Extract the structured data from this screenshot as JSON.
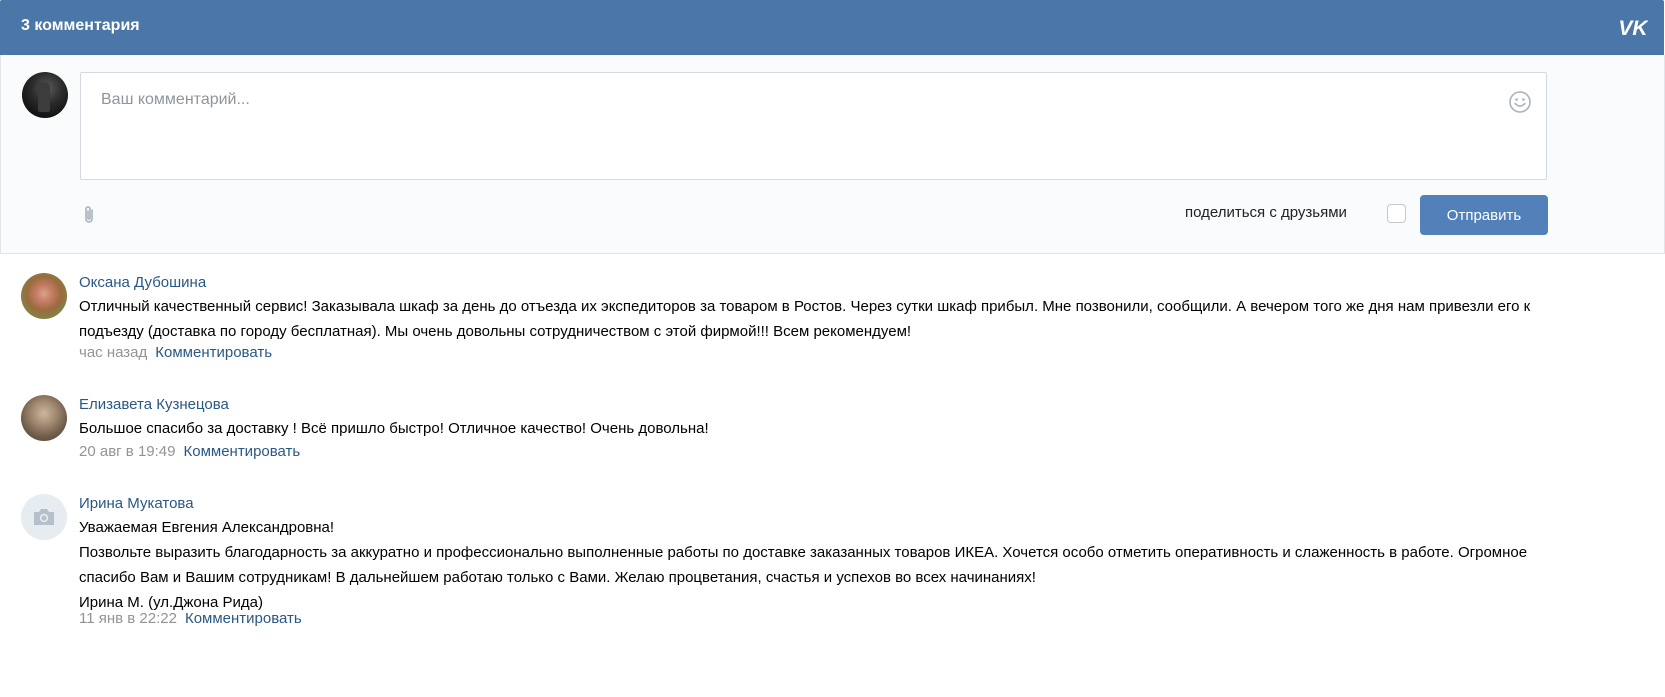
{
  "header": {
    "title": "3 комментария",
    "logo": "VK"
  },
  "compose": {
    "placeholder": "Ваш комментарий...",
    "share_label": "поделиться с друзьями",
    "share_checked": false,
    "send_label": "Отправить"
  },
  "comments": [
    {
      "author": "Оксана Дубошина",
      "text": "Отличный качественный сервис! Заказывала шкаф за день до отъезда их экспедиторов за товаром в Ростов. Через сутки шкаф прибыл. Мне позвонили, сообщили. А вечером того же дня нам привезли его к подъезду (доставка по городу бесплатная). Мы очень довольны сотрудничеством с этой фирмой!!! Всем рекомендуем!",
      "time": "час назад",
      "reply_label": "Комментировать"
    },
    {
      "author": "Елизавета Кузнецова",
      "text": "Большое спасибо за доставку ! Всё пришло быстро! Отличное качество! Очень довольна!",
      "time": "20 авг в 19:49",
      "reply_label": "Комментировать"
    },
    {
      "author": "Ирина Мукатова",
      "text": "Уважаемая Евгения Александровна!\nПозвольте выразить благодарность за аккуратно и профессионально выполненные работы по доставке заказанных товаров ИКЕА. Хочется особо отметить оперативность и слаженность в работе. Огромное спасибо Вам и Вашим сотрудникам! В дальнейшем работаю только с Вами. Желаю процветания, счастья и успехов во всех начинаниях!\nИрина М. (ул.Джона Рида)",
      "time": "11 янв в 22:22",
      "reply_label": "Комментировать"
    }
  ],
  "colors": {
    "header_bg": "#4a76a8",
    "link": "#2a5885",
    "button": "#5181b8",
    "meta": "#939393"
  },
  "icons": [
    "vk-logo-icon",
    "smile-icon",
    "paperclip-icon",
    "camera-icon"
  ]
}
